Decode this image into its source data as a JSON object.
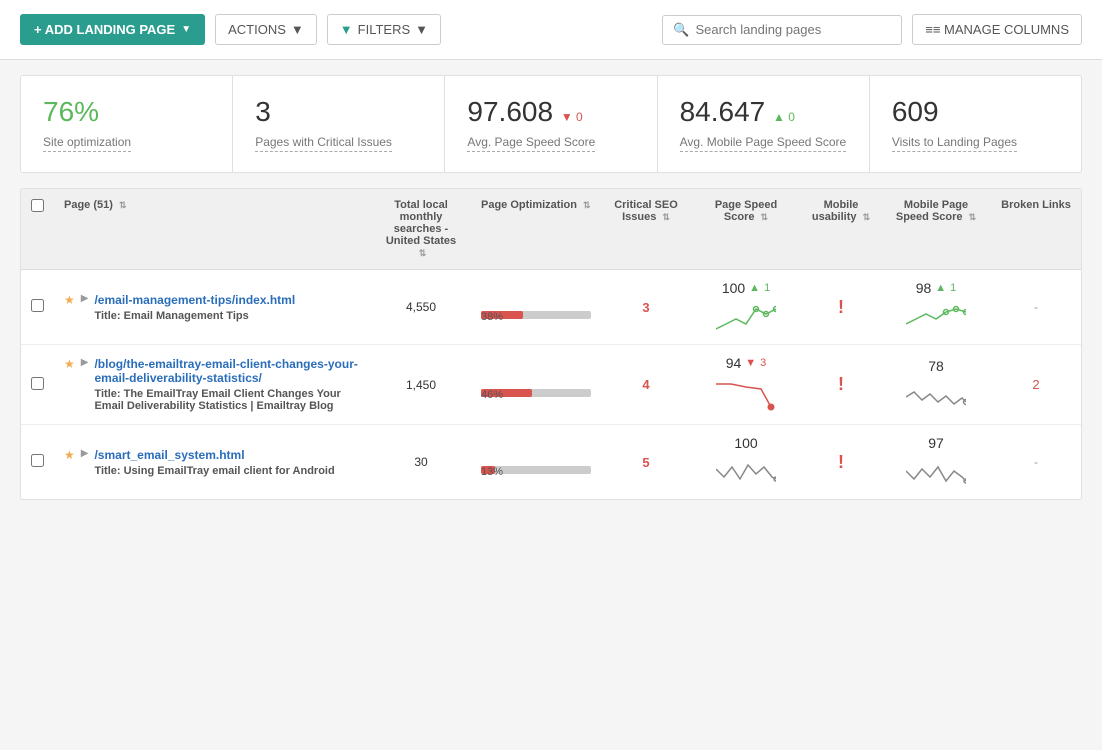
{
  "topbar": {
    "add_label": "+ ADD LANDING PAGE",
    "add_caret": "▼",
    "actions_label": "ACTIONS",
    "actions_caret": "▼",
    "filters_label": "FILTERS",
    "filters_caret": "▼",
    "search_placeholder": "Search landing pages",
    "manage_label": "≡≡ MANAGE COLUMNS"
  },
  "stats": [
    {
      "value": "76%",
      "label": "Site optimization",
      "green": true
    },
    {
      "value": "3",
      "label": "Pages with Critical Issues",
      "green": false
    },
    {
      "value": "97.608",
      "label": "Avg. Page Speed Score",
      "delta": "0",
      "delta_type": "red",
      "delta_dir": "▼"
    },
    {
      "value": "84.647",
      "label": "Avg. Mobile Page Speed Score",
      "delta": "0",
      "delta_type": "green",
      "delta_dir": "▲"
    },
    {
      "value": "609",
      "label": "Visits to Landing Pages",
      "green": false
    }
  ],
  "table": {
    "headers": [
      {
        "label": "Page (51)",
        "sortable": true
      },
      {
        "label": "Total local monthly searches - United States",
        "sortable": true
      },
      {
        "label": "Page Optimization",
        "sortable": true
      },
      {
        "label": "Critical SEO Issues",
        "sortable": true
      },
      {
        "label": "Page Speed Score",
        "sortable": true
      },
      {
        "label": "Mobile usability",
        "sortable": true
      },
      {
        "label": "Mobile Page Speed Score",
        "sortable": true
      },
      {
        "label": "Broken Links",
        "sortable": false
      }
    ],
    "rows": [
      {
        "url": "/email-management-tips/index.html",
        "title": "Email Management Tips",
        "searches": "4,550",
        "optim_pct": 38,
        "crit_issues": "3",
        "speed_score": "100",
        "speed_delta_dir": "up",
        "speed_delta": "1",
        "mobile_usability": "!",
        "mob_speed": "98",
        "mob_speed_delta_dir": "up",
        "mob_speed_delta": "1",
        "broken": "-",
        "sparkline_speed": "up",
        "sparkline_mob": "up"
      },
      {
        "url": "/blog/the-emailtray-email-client-changes-your-email-deliverability-statistics/",
        "title": "The EmailTray Email Client Changes Your Email Deliverability Statistics | Emailtray Blog",
        "searches": "1,450",
        "optim_pct": 46,
        "crit_issues": "4",
        "speed_score": "94",
        "speed_delta_dir": "down",
        "speed_delta": "3",
        "mobile_usability": "!",
        "mob_speed": "78",
        "mob_speed_delta_dir": "none",
        "mob_speed_delta": "",
        "broken": "2",
        "sparkline_speed": "down",
        "sparkline_mob": "wavy"
      },
      {
        "url": "/smart_email_system.html",
        "title": "Using EmailTray email client for Android",
        "searches": "30",
        "optim_pct": 13,
        "crit_issues": "5",
        "speed_score": "100",
        "speed_delta_dir": "none",
        "speed_delta": "",
        "mobile_usability": "!",
        "mob_speed": "97",
        "mob_speed_delta_dir": "none",
        "mob_speed_delta": "",
        "broken": "-",
        "sparkline_speed": "wavy2",
        "sparkline_mob": "wavy3"
      }
    ]
  }
}
